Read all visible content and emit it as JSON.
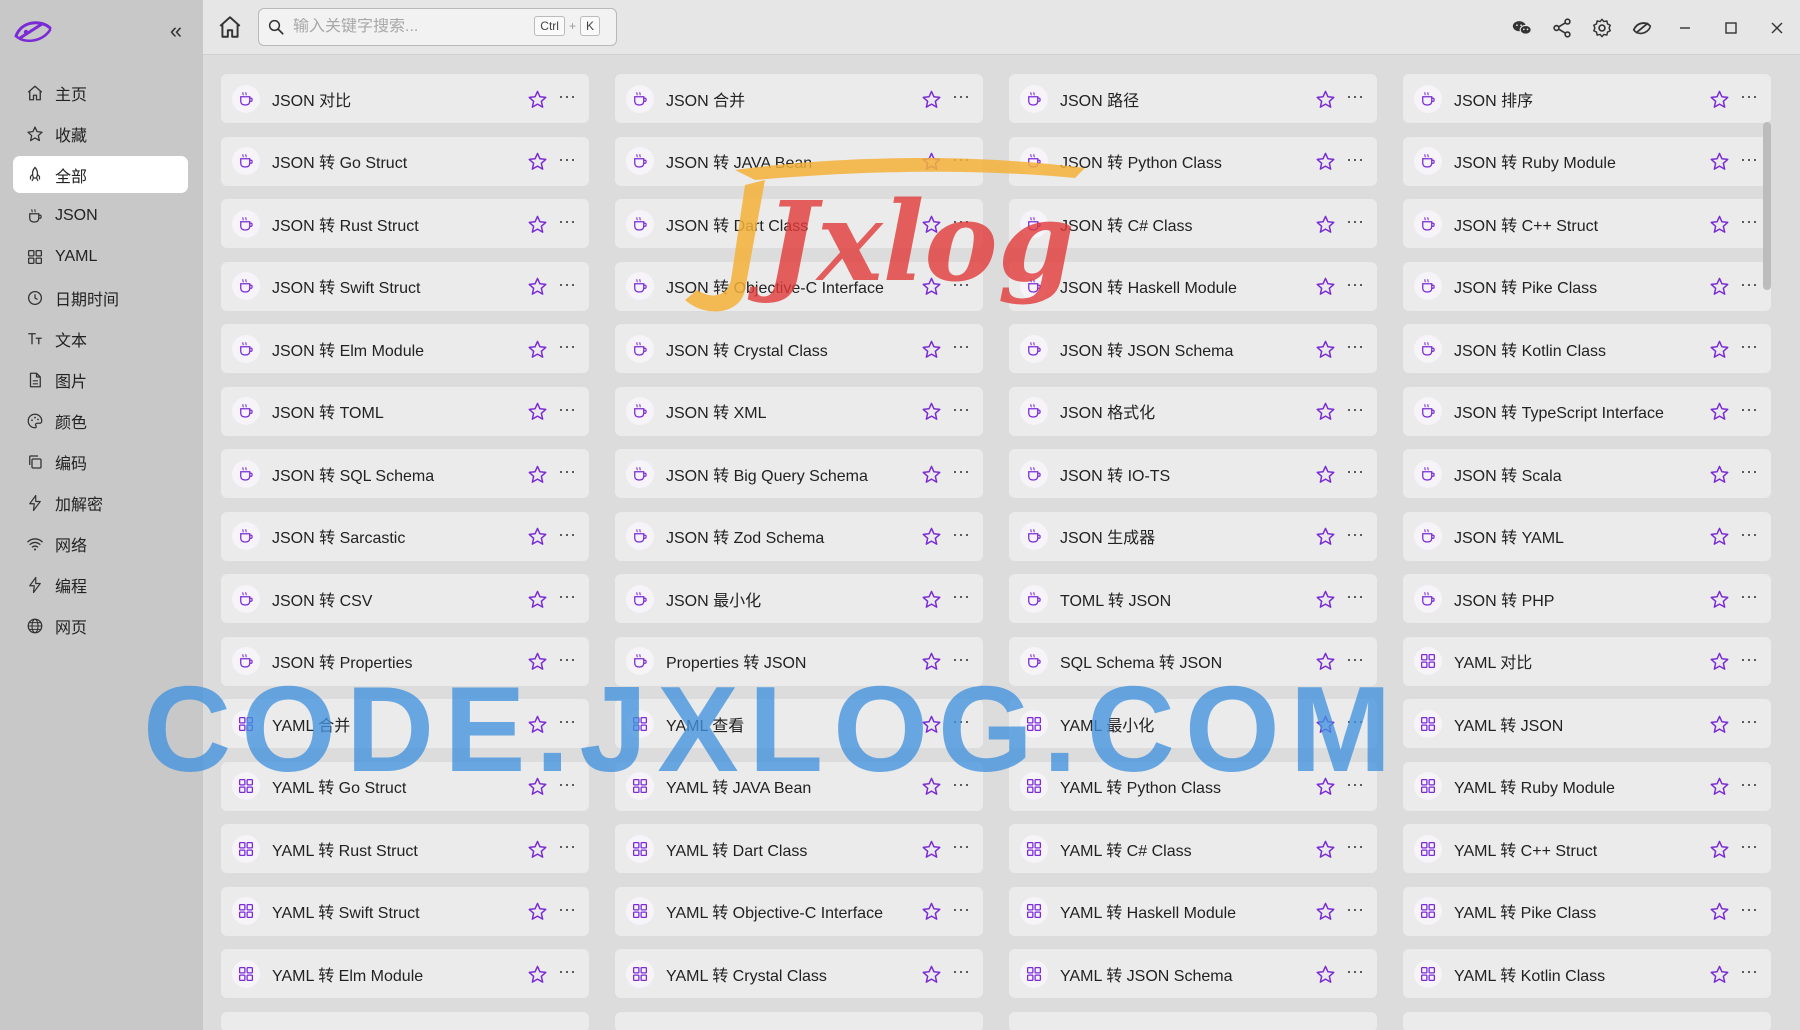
{
  "colors": {
    "accent": "#7a2bd6",
    "sidebar_bg": "#c8c8c8",
    "card_bg": "#ebebeb",
    "active_bg": "#ffffff",
    "watermark_blue": "#4292de",
    "watermark_orange": "#f5b23a",
    "watermark_red": "#e23a3a"
  },
  "sidebar": {
    "collapse_icon": "chevrons-left-icon",
    "items": [
      {
        "label": "主页",
        "icon": "home-icon",
        "active": false
      },
      {
        "label": "收藏",
        "icon": "star-icon",
        "active": false
      },
      {
        "label": "全部",
        "icon": "rocket-icon",
        "active": true
      },
      {
        "label": "JSON",
        "icon": "cup-icon",
        "active": false
      },
      {
        "label": "YAML",
        "icon": "grid-icon",
        "active": false
      },
      {
        "label": "日期时间",
        "icon": "clock-icon",
        "active": false
      },
      {
        "label": "文本",
        "icon": "text-icon",
        "active": false
      },
      {
        "label": "图片",
        "icon": "file-icon",
        "active": false
      },
      {
        "label": "颜色",
        "icon": "palette-icon",
        "active": false
      },
      {
        "label": "编码",
        "icon": "copy-icon",
        "active": false
      },
      {
        "label": "加解密",
        "icon": "bolt-icon",
        "active": false
      },
      {
        "label": "网络",
        "icon": "wifi-icon",
        "active": false
      },
      {
        "label": "编程",
        "icon": "bolt-icon",
        "active": false
      },
      {
        "label": "网页",
        "icon": "globe-icon",
        "active": false
      }
    ]
  },
  "topbar": {
    "search_placeholder": "输入关键字搜索...",
    "shortcut_ctrl": "Ctrl",
    "shortcut_plus": "+",
    "shortcut_key": "K",
    "right_icons": [
      "wechat-icon",
      "share-icon",
      "settings-icon",
      "rocket-icon"
    ]
  },
  "cards": [
    {
      "title": "JSON 对比",
      "icon": "cup-icon"
    },
    {
      "title": "JSON 合并",
      "icon": "cup-icon"
    },
    {
      "title": "JSON 路径",
      "icon": "cup-icon"
    },
    {
      "title": "JSON 排序",
      "icon": "cup-icon"
    },
    {
      "title": "JSON 转 Go Struct",
      "icon": "cup-icon"
    },
    {
      "title": "JSON 转 JAVA Bean",
      "icon": "cup-icon"
    },
    {
      "title": "JSON 转 Python Class",
      "icon": "cup-icon"
    },
    {
      "title": "JSON 转 Ruby Module",
      "icon": "cup-icon"
    },
    {
      "title": "JSON 转 Rust Struct",
      "icon": "cup-icon"
    },
    {
      "title": "JSON 转 Dart Class",
      "icon": "cup-icon"
    },
    {
      "title": "JSON 转 C# Class",
      "icon": "cup-icon"
    },
    {
      "title": "JSON 转 C++ Struct",
      "icon": "cup-icon"
    },
    {
      "title": "JSON 转 Swift Struct",
      "icon": "cup-icon"
    },
    {
      "title": "JSON 转 Objective-C Interface",
      "icon": "cup-icon"
    },
    {
      "title": "JSON 转 Haskell Module",
      "icon": "cup-icon"
    },
    {
      "title": "JSON 转 Pike Class",
      "icon": "cup-icon"
    },
    {
      "title": "JSON 转 Elm Module",
      "icon": "cup-icon"
    },
    {
      "title": "JSON 转 Crystal Class",
      "icon": "cup-icon"
    },
    {
      "title": "JSON 转 JSON Schema",
      "icon": "cup-icon"
    },
    {
      "title": "JSON 转 Kotlin Class",
      "icon": "cup-icon"
    },
    {
      "title": "JSON 转 TOML",
      "icon": "cup-icon"
    },
    {
      "title": "JSON 转 XML",
      "icon": "cup-icon"
    },
    {
      "title": "JSON 格式化",
      "icon": "cup-icon"
    },
    {
      "title": "JSON 转 TypeScript Interface",
      "icon": "cup-icon"
    },
    {
      "title": "JSON 转 SQL Schema",
      "icon": "cup-icon"
    },
    {
      "title": "JSON 转 Big Query Schema",
      "icon": "cup-icon"
    },
    {
      "title": "JSON 转 IO-TS",
      "icon": "cup-icon"
    },
    {
      "title": "JSON 转 Scala",
      "icon": "cup-icon"
    },
    {
      "title": "JSON 转 Sarcastic",
      "icon": "cup-icon"
    },
    {
      "title": "JSON 转 Zod Schema",
      "icon": "cup-icon"
    },
    {
      "title": "JSON 生成器",
      "icon": "cup-icon"
    },
    {
      "title": "JSON 转 YAML",
      "icon": "cup-icon"
    },
    {
      "title": "JSON 转 CSV",
      "icon": "cup-icon"
    },
    {
      "title": "JSON 最小化",
      "icon": "cup-icon"
    },
    {
      "title": "TOML 转 JSON",
      "icon": "cup-icon"
    },
    {
      "title": "JSON 转 PHP",
      "icon": "cup-icon"
    },
    {
      "title": "JSON 转 Properties",
      "icon": "cup-icon"
    },
    {
      "title": "Properties 转 JSON",
      "icon": "cup-icon"
    },
    {
      "title": "SQL Schema 转 JSON",
      "icon": "cup-icon"
    },
    {
      "title": "YAML 对比",
      "icon": "grid-icon"
    },
    {
      "title": "YAML 合并",
      "icon": "grid-icon"
    },
    {
      "title": "YAML 查看",
      "icon": "grid-icon"
    },
    {
      "title": "YAML 最小化",
      "icon": "grid-icon"
    },
    {
      "title": "YAML 转 JSON",
      "icon": "grid-icon"
    },
    {
      "title": "YAML 转 Go Struct",
      "icon": "grid-icon"
    },
    {
      "title": "YAML 转 JAVA Bean",
      "icon": "grid-icon"
    },
    {
      "title": "YAML 转 Python Class",
      "icon": "grid-icon"
    },
    {
      "title": "YAML 转 Ruby Module",
      "icon": "grid-icon"
    },
    {
      "title": "YAML 转 Rust Struct",
      "icon": "grid-icon"
    },
    {
      "title": "YAML 转 Dart Class",
      "icon": "grid-icon"
    },
    {
      "title": "YAML 转 C# Class",
      "icon": "grid-icon"
    },
    {
      "title": "YAML 转 C++ Struct",
      "icon": "grid-icon"
    },
    {
      "title": "YAML 转 Swift Struct",
      "icon": "grid-icon"
    },
    {
      "title": "YAML 转 Objective-C Interface",
      "icon": "grid-icon"
    },
    {
      "title": "YAML 转 Haskell Module",
      "icon": "grid-icon"
    },
    {
      "title": "YAML 转 Pike Class",
      "icon": "grid-icon"
    },
    {
      "title": "YAML 转 Elm Module",
      "icon": "grid-icon"
    },
    {
      "title": "YAML 转 Crystal Class",
      "icon": "grid-icon"
    },
    {
      "title": "YAML 转 JSON Schema",
      "icon": "grid-icon"
    },
    {
      "title": "YAML 转 Kotlin Class",
      "icon": "grid-icon"
    }
  ],
  "card_actions": {
    "star_icon": "star-icon",
    "more_label": "···"
  },
  "watermarks": {
    "logo_text": "Jxlog",
    "big_text": "CODE.JXLOG.COM"
  }
}
